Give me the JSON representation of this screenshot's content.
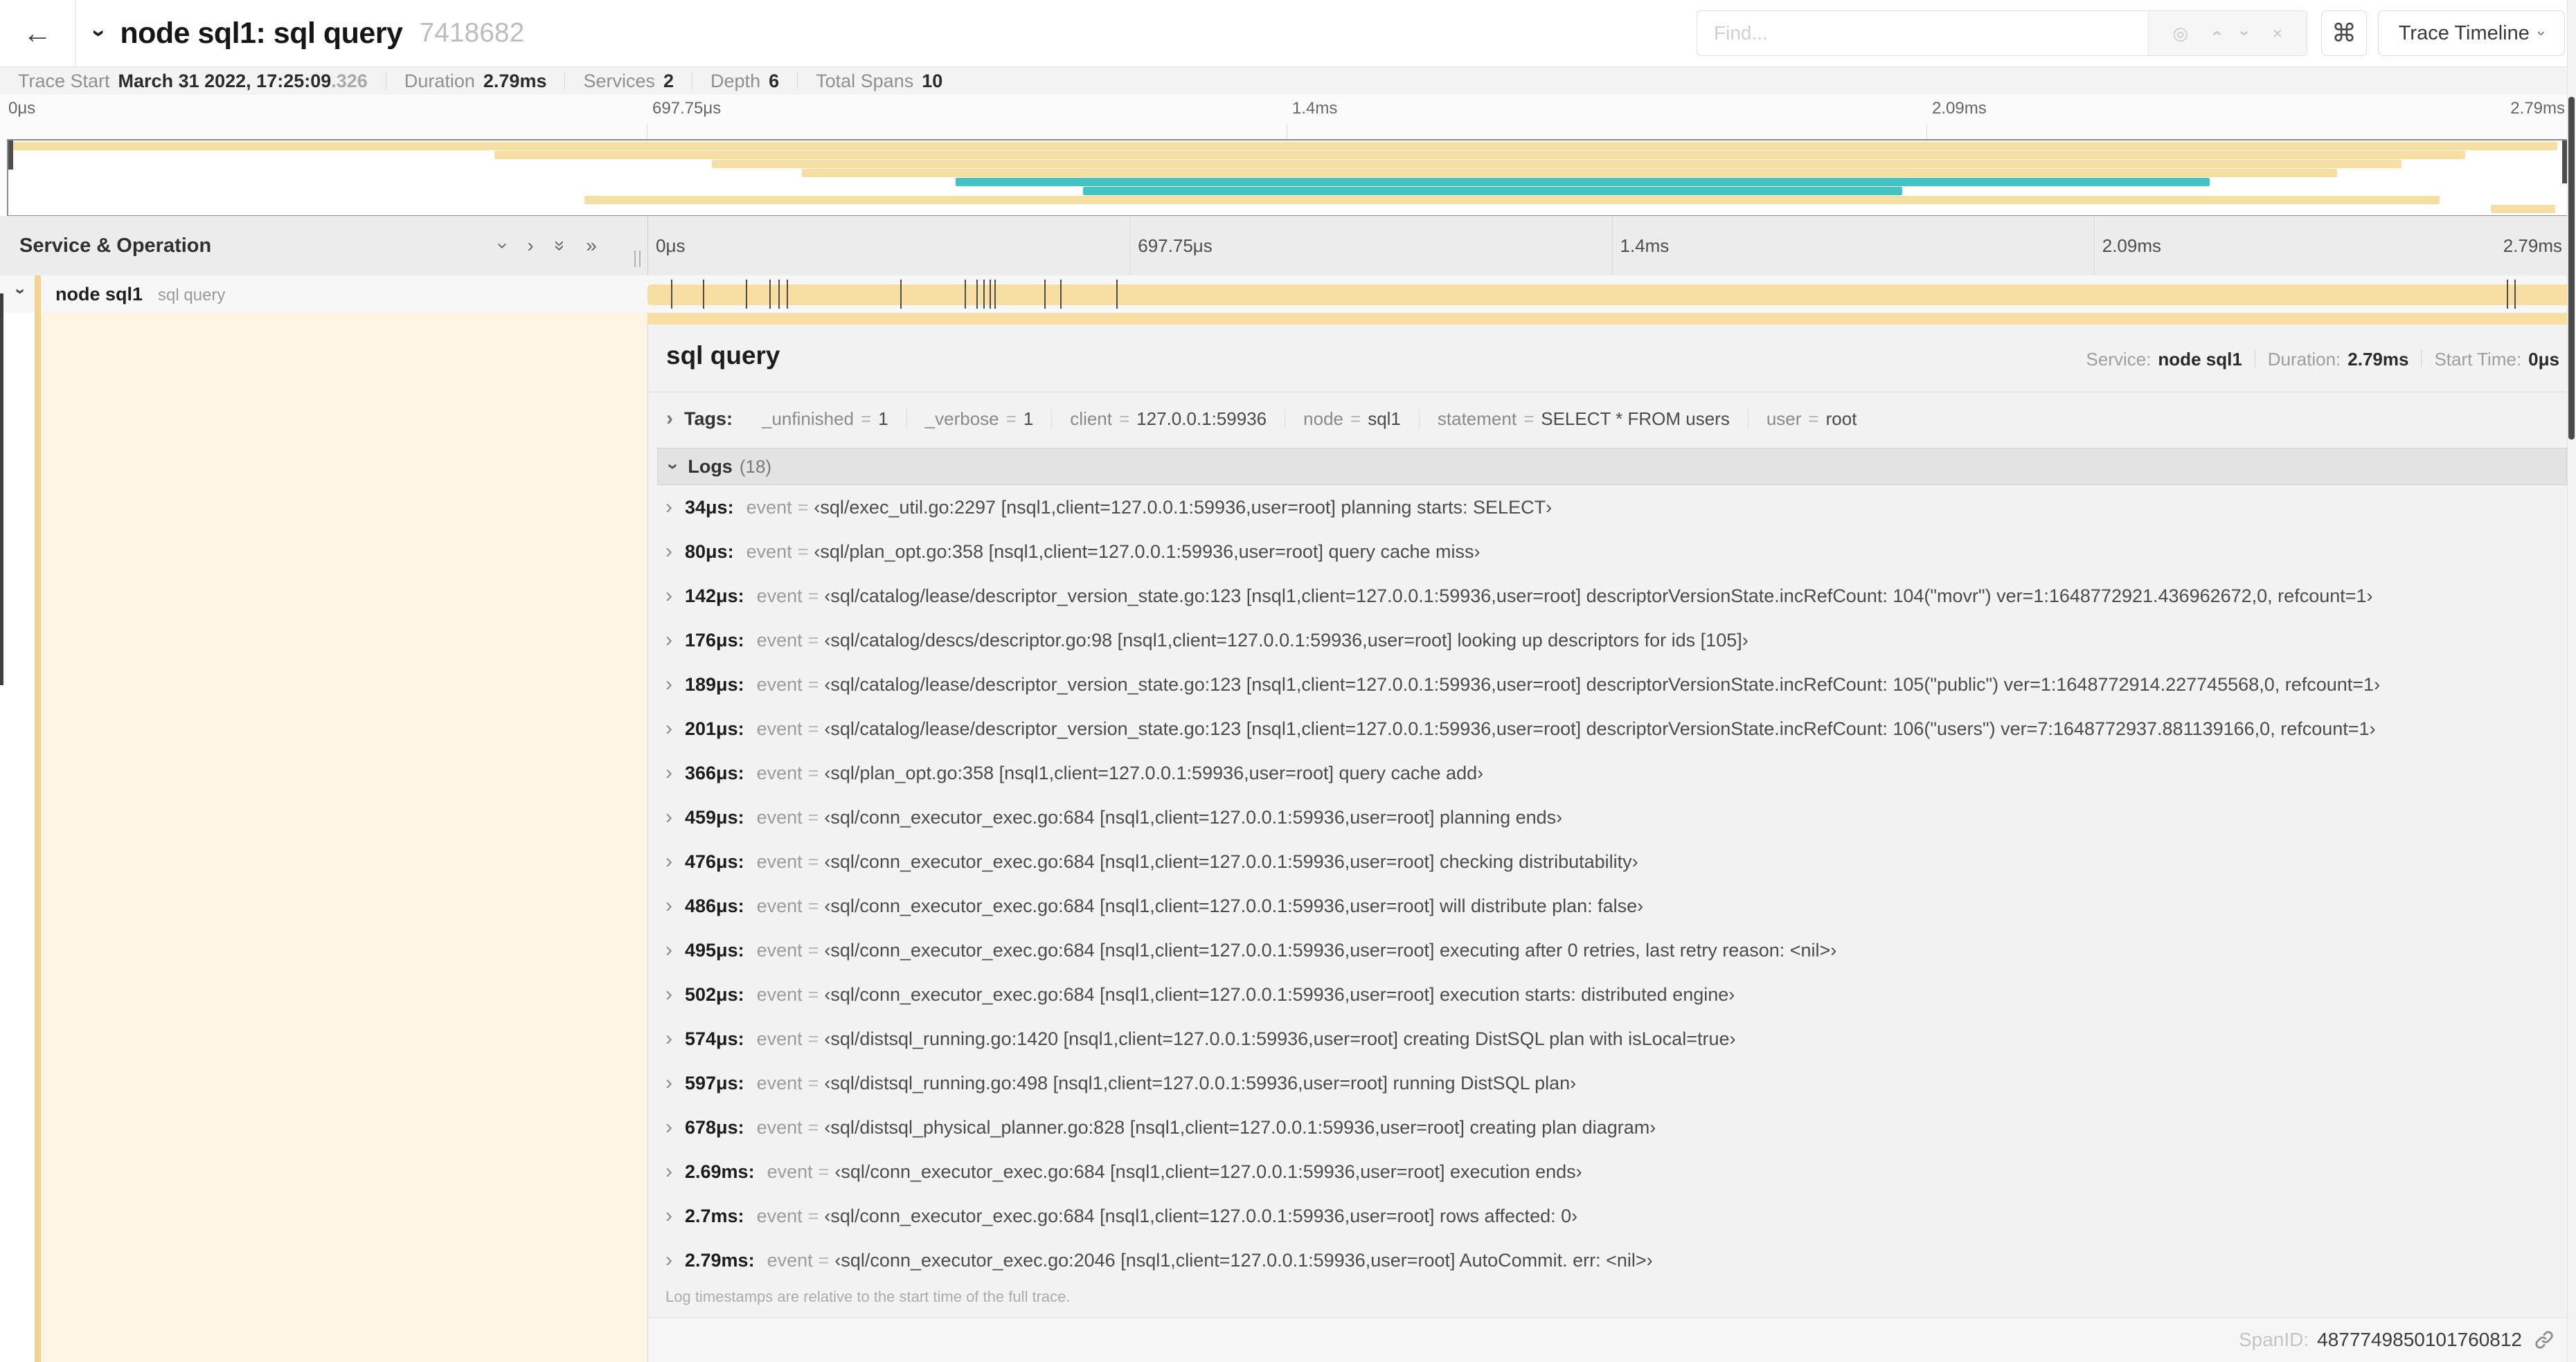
{
  "header": {
    "back_arrow": "←",
    "collapse_chevron": "›",
    "title": "node sql1: sql query",
    "trace_id": "7418682",
    "find_placeholder": "Find...",
    "target_icon": "◎",
    "prev_icon": "›",
    "next_icon": "›",
    "clear_icon": "×",
    "shortcut_icon": "⌘",
    "view_button": "Trace Timeline",
    "view_chevron": "›"
  },
  "summary": [
    {
      "label": "Trace Start",
      "value": "March 31 2022, 17:25:09",
      "suffix": ".326"
    },
    {
      "label": "Duration",
      "value": "2.79ms",
      "suffix": ""
    },
    {
      "label": "Services",
      "value": "2",
      "suffix": ""
    },
    {
      "label": "Depth",
      "value": "6",
      "suffix": ""
    },
    {
      "label": "Total Spans",
      "value": "10",
      "suffix": ""
    }
  ],
  "timeline": {
    "ticks": [
      "0μs",
      "697.75μs",
      "1.4ms",
      "2.09ms",
      "2.79ms"
    ],
    "tick_positions": [
      0,
      25,
      50,
      75,
      100
    ]
  },
  "minimap": {
    "spans": [
      {
        "r": 0,
        "s": 0,
        "e": 99.6,
        "c": "tan"
      },
      {
        "r": 1,
        "s": 19,
        "e": 96,
        "c": "tan"
      },
      {
        "r": 2,
        "s": 27.5,
        "e": 93.5,
        "c": "tan"
      },
      {
        "r": 3,
        "s": 31,
        "e": 91,
        "c": "tan"
      },
      {
        "r": 4,
        "s": 37,
        "e": 86,
        "c": "teal"
      },
      {
        "r": 5,
        "s": 42,
        "e": 74,
        "c": "teal"
      },
      {
        "r": 6,
        "s": 22.5,
        "e": 95,
        "c": "tan"
      },
      {
        "r": 7,
        "s": 97,
        "e": 99.5,
        "c": "tan"
      }
    ]
  },
  "table": {
    "header_label": "Service & Operation",
    "collapse_one_icon": "›",
    "expand_one_icon": "›",
    "collapse_all_icon": "»",
    "expand_all_icon": "»"
  },
  "span_row": {
    "service": "node sql1",
    "operation": "sql query",
    "chevron": "›",
    "log_tick_positions": [
      1.22,
      2.87,
      5.09,
      6.31,
      6.77,
      7.2,
      13.12,
      16.45,
      17.06,
      17.42,
      17.74,
      18.0,
      20.57,
      21.4,
      24.3,
      96.4,
      96.8,
      99.85
    ]
  },
  "detail": {
    "title": "sql query",
    "meta": [
      {
        "label": "Service:",
        "value": "node sql1"
      },
      {
        "label": "Duration:",
        "value": "2.79ms"
      },
      {
        "label": "Start Time:",
        "value": "0μs"
      }
    ],
    "tags": {
      "chevron": "›",
      "label": "Tags:",
      "items": [
        {
          "key": "_unfinished",
          "value": "1"
        },
        {
          "key": "_verbose",
          "value": "1"
        },
        {
          "key": "client",
          "value": "127.0.0.1:59936"
        },
        {
          "key": "node",
          "value": "sql1"
        },
        {
          "key": "statement",
          "value": "SELECT * FROM users"
        },
        {
          "key": "user",
          "value": "root"
        }
      ]
    },
    "logs": {
      "label": "Logs",
      "count": "(18)",
      "field_label": "event",
      "eq": "=",
      "row_chevron": "›",
      "entries": [
        {
          "time": "34μs:",
          "value": "‹sql/exec_util.go:2297 [nsql1,client=127.0.0.1:59936,user=root] planning starts: SELECT›"
        },
        {
          "time": "80μs:",
          "value": "‹sql/plan_opt.go:358 [nsql1,client=127.0.0.1:59936,user=root] query cache miss›"
        },
        {
          "time": "142μs:",
          "value": "‹sql/catalog/lease/descriptor_version_state.go:123 [nsql1,client=127.0.0.1:59936,user=root] descriptorVersionState.incRefCount: 104(\"movr\") ver=1:1648772921.436962672,0, refcount=1›"
        },
        {
          "time": "176μs:",
          "value": "‹sql/catalog/descs/descriptor.go:98 [nsql1,client=127.0.0.1:59936,user=root] looking up descriptors for ids [105]›"
        },
        {
          "time": "189μs:",
          "value": "‹sql/catalog/lease/descriptor_version_state.go:123 [nsql1,client=127.0.0.1:59936,user=root] descriptorVersionState.incRefCount: 105(\"public\") ver=1:1648772914.227745568,0, refcount=1›"
        },
        {
          "time": "201μs:",
          "value": "‹sql/catalog/lease/descriptor_version_state.go:123 [nsql1,client=127.0.0.1:59936,user=root] descriptorVersionState.incRefCount: 106(\"users\") ver=7:1648772937.881139166,0, refcount=1›"
        },
        {
          "time": "366μs:",
          "value": "‹sql/plan_opt.go:358 [nsql1,client=127.0.0.1:59936,user=root] query cache add›"
        },
        {
          "time": "459μs:",
          "value": "‹sql/conn_executor_exec.go:684 [nsql1,client=127.0.0.1:59936,user=root] planning ends›"
        },
        {
          "time": "476μs:",
          "value": "‹sql/conn_executor_exec.go:684 [nsql1,client=127.0.0.1:59936,user=root] checking distributability›"
        },
        {
          "time": "486μs:",
          "value": "‹sql/conn_executor_exec.go:684 [nsql1,client=127.0.0.1:59936,user=root] will distribute plan: false›"
        },
        {
          "time": "495μs:",
          "value": "‹sql/conn_executor_exec.go:684 [nsql1,client=127.0.0.1:59936,user=root] executing after 0 retries, last retry reason: <nil>›"
        },
        {
          "time": "502μs:",
          "value": "‹sql/conn_executor_exec.go:684 [nsql1,client=127.0.0.1:59936,user=root] execution starts: distributed engine›"
        },
        {
          "time": "574μs:",
          "value": "‹sql/distsql_running.go:1420 [nsql1,client=127.0.0.1:59936,user=root] creating DistSQL plan with isLocal=true›"
        },
        {
          "time": "597μs:",
          "value": "‹sql/distsql_running.go:498 [nsql1,client=127.0.0.1:59936,user=root] running DistSQL plan›"
        },
        {
          "time": "678μs:",
          "value": "‹sql/distsql_physical_planner.go:828 [nsql1,client=127.0.0.1:59936,user=root] creating plan diagram›"
        },
        {
          "time": "2.69ms:",
          "value": "‹sql/conn_executor_exec.go:684 [nsql1,client=127.0.0.1:59936,user=root] execution ends›"
        },
        {
          "time": "2.7ms:",
          "value": "‹sql/conn_executor_exec.go:684 [nsql1,client=127.0.0.1:59936,user=root] rows affected: 0›"
        },
        {
          "time": "2.79ms:",
          "value": "‹sql/conn_executor_exec.go:2046 [nsql1,client=127.0.0.1:59936,user=root] AutoCommit. err: <nil>›"
        }
      ]
    },
    "note": "Log timestamps are relative to the start time of the full trace.",
    "footer": {
      "label": "SpanID:",
      "value": "4877749850101760812"
    }
  },
  "colors": {
    "span_tan": "#f7dfa4",
    "span_accent": "#f2d391",
    "span_teal": "#43c4c2",
    "row_cream": "#fdf4e6"
  }
}
